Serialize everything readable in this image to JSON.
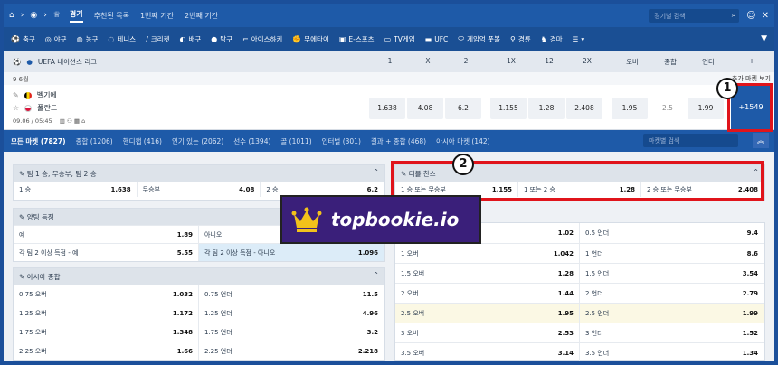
{
  "topbar": {
    "tabs": [
      {
        "label": "경기",
        "active": true
      },
      {
        "label": "추천된 목록",
        "active": false
      },
      {
        "label": "1번째 기간",
        "active": false
      },
      {
        "label": "2번째 기간",
        "active": false
      }
    ],
    "search_placeholder": "경기별 검색"
  },
  "sports": [
    "축구",
    "야구",
    "농구",
    "테니스",
    "크리켓",
    "배구",
    "탁구",
    "아이스하키",
    "무에타이",
    "E-스포츠",
    "TV게임",
    "UFC",
    "게임억 풋볼",
    "경륜",
    "경마"
  ],
  "league": {
    "name": "UEFA 네이션스 리그",
    "columns": [
      "1",
      "X",
      "2",
      "1X",
      "12",
      "2X",
      "오버",
      "종합",
      "언더",
      "+"
    ]
  },
  "date_label": "9 6월",
  "more_label": "추가 마켓 보기",
  "match": {
    "home": "벨기에",
    "away": "폴란드",
    "datetime": "09.06 / 05:45",
    "odds": [
      "1.638",
      "4.08",
      "6.2",
      "1.155",
      "1.28",
      "2.408",
      "1.95",
      "2.5",
      "1.99"
    ],
    "more": "+1549"
  },
  "market_tabs": [
    {
      "label": "모든 마켓 (7827)",
      "active": true
    },
    {
      "label": "종합 (1206)",
      "active": false
    },
    {
      "label": "핸디캡 (416)",
      "active": false
    },
    {
      "label": "인기 있는 (2062)",
      "active": false
    },
    {
      "label": "선수 (1394)",
      "active": false
    },
    {
      "label": "골 (1011)",
      "active": false
    },
    {
      "label": "인터벌 (301)",
      "active": false
    },
    {
      "label": "결과 + 종합 (468)",
      "active": false
    },
    {
      "label": "아시아 마켓 (142)",
      "active": false
    }
  ],
  "market_search": "마켓별 검색",
  "markets": {
    "team_win": {
      "title": "팀 1 승, 무승부, 팀 2 승",
      "rows": [
        [
          {
            "l": "1 승",
            "v": "1.638"
          },
          {
            "l": "무승부",
            "v": "4.08"
          },
          {
            "l": "2 승",
            "v": "6.2"
          }
        ]
      ]
    },
    "both_score": {
      "title": "양팀 득점",
      "rows": [
        [
          {
            "l": "예",
            "v": "1.89"
          },
          {
            "l": "아니오",
            "v": ""
          }
        ],
        [
          {
            "l": "각 팀 2 이상 득점 - 예",
            "v": "5.55"
          },
          {
            "l": "각 팀 2 이상 득점 - 아니오",
            "v": "1.096"
          }
        ]
      ]
    },
    "asian_total": {
      "title": "아시아 종합",
      "rows": [
        [
          {
            "l": "0.75 오버",
            "v": "1.032"
          },
          {
            "l": "0.75 언더",
            "v": "11.5"
          }
        ],
        [
          {
            "l": "1.25 오버",
            "v": "1.172"
          },
          {
            "l": "1.25 언더",
            "v": "4.96"
          }
        ],
        [
          {
            "l": "1.75 오버",
            "v": "1.348"
          },
          {
            "l": "1.75 언더",
            "v": "3.2"
          }
        ],
        [
          {
            "l": "2.25 오버",
            "v": "1.66"
          },
          {
            "l": "2.25 언더",
            "v": "2.218"
          }
        ]
      ]
    },
    "double_chance": {
      "title": "더블 찬스",
      "rows": [
        [
          {
            "l": "1 승 또는 무승부",
            "v": "1.155"
          },
          {
            "l": "1 또는 2 승",
            "v": "1.28"
          },
          {
            "l": "2 승 또는 무승부",
            "v": "2.408"
          }
        ]
      ]
    },
    "total": {
      "rows": [
        [
          {
            "l": "",
            "v": "1.02"
          },
          {
            "l": "0.5 언더",
            "v": "9.4"
          }
        ],
        [
          {
            "l": "1 오버",
            "v": "1.042"
          },
          {
            "l": "1 언더",
            "v": "8.6"
          }
        ],
        [
          {
            "l": "1.5 오버",
            "v": "1.28"
          },
          {
            "l": "1.5 언더",
            "v": "3.54"
          }
        ],
        [
          {
            "l": "2 오버",
            "v": "1.44"
          },
          {
            "l": "2 언더",
            "v": "2.79"
          }
        ],
        [
          {
            "l": "2.5 오버",
            "v": "1.95"
          },
          {
            "l": "2.5 언더",
            "v": "1.99"
          }
        ],
        [
          {
            "l": "3 오버",
            "v": "2.53"
          },
          {
            "l": "3 언더",
            "v": "1.52"
          }
        ],
        [
          {
            "l": "3.5 오버",
            "v": "3.14"
          },
          {
            "l": "3.5 언더",
            "v": "1.34"
          }
        ]
      ]
    }
  },
  "callouts": {
    "one": "1",
    "two": "2"
  },
  "watermark": "topbookie.io",
  "colors": {
    "primary": "#1e5aa8",
    "highlight": "#e0141b",
    "badge": "#3a1f7a",
    "crown": "#f2c21b"
  }
}
